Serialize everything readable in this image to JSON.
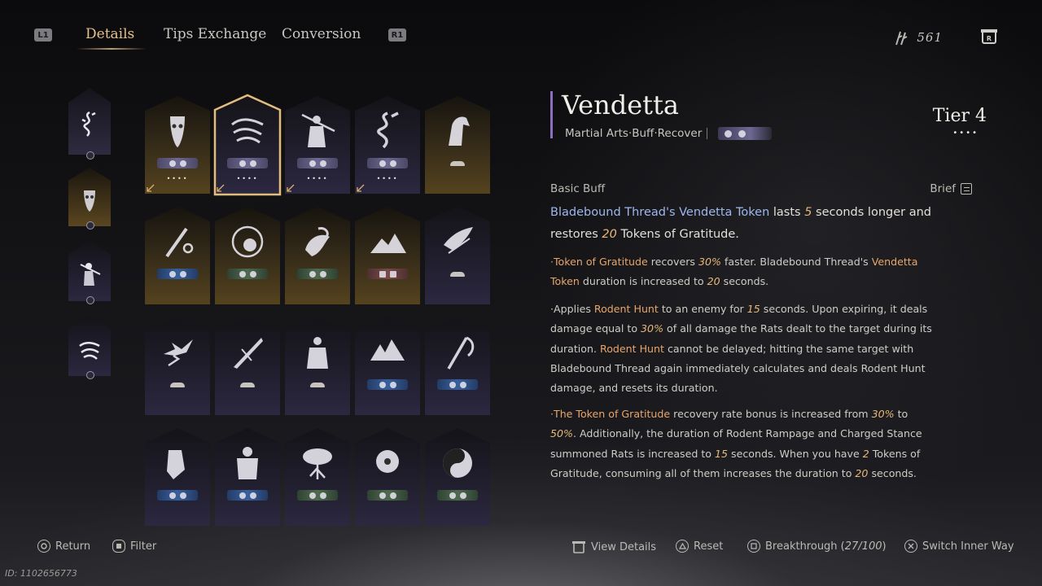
{
  "nav": {
    "left_bumper": "L1",
    "right_bumper": "R1",
    "tabs": [
      {
        "label": "Details",
        "active": true
      },
      {
        "label": "Tips Exchange",
        "active": false
      },
      {
        "label": "Conversion",
        "active": false
      }
    ],
    "currency_value": "561",
    "currency_icon": "feather-icon",
    "r3_icon": "r3-stick-icon"
  },
  "left_slots": [
    {
      "name": "slot-dragon",
      "icon": "dragon-icon",
      "theme": "purple",
      "selected": true
    },
    {
      "name": "slot-mask",
      "icon": "mask-icon",
      "theme": "gold",
      "selected": false
    },
    {
      "name": "slot-swordsman",
      "icon": "swordsman-icon",
      "theme": "purple",
      "selected": false
    },
    {
      "name": "slot-vendetta",
      "icon": "rats-icon",
      "theme": "purple",
      "selected": false
    }
  ],
  "grid_cards": [
    {
      "name": "card-mask",
      "icon": "mask-icon",
      "theme": "gold",
      "pill": "purple",
      "glyph": "circle",
      "dots": "••••"
    },
    {
      "name": "card-vendetta",
      "icon": "rats-icon",
      "theme": "purple",
      "pill": "purple",
      "glyph": "circle",
      "dots": "••••",
      "selected": true
    },
    {
      "name": "card-swordsman",
      "icon": "swordsman-icon",
      "theme": "purple",
      "pill": "purple",
      "glyph": "circle",
      "dots": "••••"
    },
    {
      "name": "card-dragon",
      "icon": "dragon-icon",
      "theme": "purple",
      "pill": "purple",
      "glyph": "circle",
      "dots": "••••"
    },
    {
      "name": "card-horse",
      "icon": "horse-icon",
      "theme": "gold",
      "pill": "none",
      "glyph": "mound",
      "dots": ""
    },
    {
      "name": "card-bell",
      "icon": "bell-icon",
      "theme": "gold",
      "pill": "blue",
      "glyph": "circle",
      "dots": ""
    },
    {
      "name": "card-lotus",
      "icon": "lotus-icon",
      "theme": "gold",
      "pill": "green",
      "glyph": "circle",
      "dots": ""
    },
    {
      "name": "card-gourd",
      "icon": "gourd-icon",
      "theme": "gold",
      "pill": "green",
      "glyph": "circle",
      "dots": ""
    },
    {
      "name": "card-mountain",
      "icon": "mountain-icon",
      "theme": "gold",
      "pill": "red",
      "glyph": "square",
      "dots": ""
    },
    {
      "name": "card-crow",
      "icon": "crow-icon",
      "theme": "purple",
      "pill": "none",
      "glyph": "mound",
      "dots": ""
    },
    {
      "name": "card-swallows",
      "icon": "swallows-icon",
      "theme": "purple",
      "pill": "none",
      "glyph": "mound",
      "dots": ""
    },
    {
      "name": "card-blade",
      "icon": "blade-icon",
      "theme": "purple",
      "pill": "none",
      "glyph": "mound",
      "dots": ""
    },
    {
      "name": "card-warrior",
      "icon": "warrior-icon",
      "theme": "purple",
      "pill": "none",
      "glyph": "mound",
      "dots": ""
    },
    {
      "name": "card-peaks",
      "icon": "peaks-icon",
      "theme": "purple",
      "pill": "blue",
      "glyph": "circle",
      "dots": ""
    },
    {
      "name": "card-scythe",
      "icon": "scythe-icon",
      "theme": "purple",
      "pill": "blue",
      "glyph": "circle",
      "dots": ""
    },
    {
      "name": "card-palm",
      "icon": "palm-icon",
      "theme": "purple",
      "pill": "blue",
      "glyph": "circle",
      "dots": ""
    },
    {
      "name": "card-armor",
      "icon": "armor-icon",
      "theme": "purple",
      "pill": "blue",
      "glyph": "circle",
      "dots": ""
    },
    {
      "name": "card-tree",
      "icon": "tree-icon",
      "theme": "purple",
      "pill": "green",
      "glyph": "circle",
      "dots": ""
    },
    {
      "name": "card-flower",
      "icon": "flower-icon",
      "theme": "purple",
      "pill": "green",
      "glyph": "circle",
      "dots": ""
    },
    {
      "name": "card-yinyang",
      "icon": "yinyang-icon",
      "theme": "purple",
      "pill": "green",
      "glyph": "circle",
      "dots": ""
    }
  ],
  "detail": {
    "title": "Vendetta",
    "subtitle": "Martial Arts·Buff·Recover",
    "tier_label": "Tier",
    "tier_value": "4",
    "tier_dots": "••••",
    "section_label": "Basic Buff",
    "brief_label": "Brief",
    "main_desc": {
      "p1": "Bladebound Thread's Vendetta Token",
      "p2": " lasts ",
      "p3": "5",
      "p4": " seconds longer and restores ",
      "p5": "20",
      "p6": " Tokens of Gratitude."
    },
    "para1": {
      "a": "·Token of Gratitude",
      "b": " recovers ",
      "c": "30%",
      "d": " faster. Bladebound Thread's ",
      "e": "Vendetta Token",
      "f": " duration is increased to ",
      "g": "20",
      "h": " seconds."
    },
    "para2": {
      "a": "·Applies ",
      "b": "Rodent Hunt",
      "c": " to an enemy for ",
      "d": "15",
      "e": " seconds. Upon expiring, it deals damage equal to ",
      "f": "30%",
      "g": " of all damage the Rats dealt to the target during its duration. ",
      "h": "Rodent Hunt",
      "i": " cannot be delayed; hitting the same target with Bladebound Thread again immediately calculates and deals Rodent Hunt damage, and resets its duration."
    },
    "para3": {
      "a": "·The Token of Gratitude",
      "b": " recovery rate bonus is increased from ",
      "c": "30%",
      "d": " to ",
      "e": "50%",
      "f": ". Additionally, the duration of Rodent Rampage and Charged Stance summoned Rats is increased to ",
      "g": "15",
      "h": " seconds. When you have ",
      "i": "2",
      "j": " Tokens of Gratitude, consuming all of them increases the duration to ",
      "k": "20",
      "l": " seconds."
    }
  },
  "bottom": {
    "return": "Return",
    "filter": "Filter",
    "view_details": "View Details",
    "reset": "Reset",
    "breakthrough_label": "Breakthrough (",
    "breakthrough_value": "27/100",
    "breakthrough_close": ")",
    "switch": "Switch Inner Way",
    "id_text": "ID: 1102656773"
  },
  "colors": {
    "accent_gold": "#e6c189",
    "highlight_blue": "#9db7ee",
    "highlight_orange": "#e7a56c",
    "title_bar": "#8d6fc2"
  }
}
